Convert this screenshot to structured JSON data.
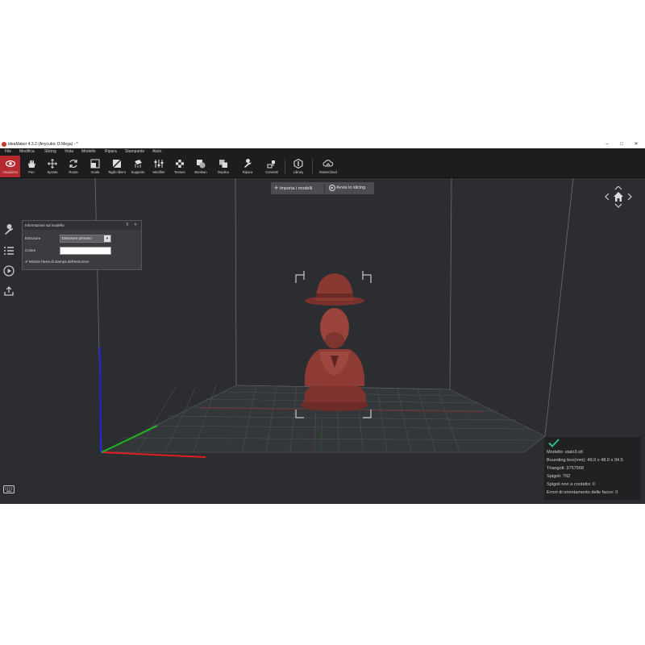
{
  "window": {
    "title": "ideaMaker 4.3.2 (Anycubic I3 Mega) - *",
    "controls": [
      "–",
      "□",
      "✕"
    ]
  },
  "menu": [
    "File",
    "Modifica",
    "Slicing",
    "Vista",
    "Modello",
    "Ripara",
    "Stampante",
    "Aiuto"
  ],
  "toolbar": [
    {
      "label": "Visualizza",
      "icon": "eye-icon",
      "active": true
    },
    {
      "label": "Pan",
      "icon": "hand-icon"
    },
    {
      "label": "Sposta",
      "icon": "move-icon"
    },
    {
      "label": "Ruota",
      "icon": "rotate-icon"
    },
    {
      "label": "Scala",
      "icon": "scale-icon"
    },
    {
      "label": "Taglio libero",
      "icon": "cut-icon"
    },
    {
      "label": "Supporto",
      "icon": "support-icon"
    },
    {
      "label": "Modifier",
      "icon": "modifier-icon"
    },
    {
      "label": "Texture",
      "icon": "texture-icon"
    },
    {
      "label": "Boolean",
      "icon": "boolean-icon"
    },
    {
      "label": "Duplica",
      "icon": "duplicate-icon"
    },
    {
      "label": "Ripara",
      "icon": "repair-icon"
    },
    {
      "label": "Connetti",
      "icon": "connect-icon"
    },
    {
      "label": "Library",
      "icon": "library-icon"
    },
    {
      "label": "RaiseCloud",
      "icon": "cloud-icon"
    }
  ],
  "actions": {
    "import_label": "Importa i modelli",
    "slice_label": "Avvia lo slicing"
  },
  "panel": {
    "title": "Informazioni sul modello",
    "extruder_label": "Estrusore",
    "extruder_value": "Estrusore primario",
    "color_label": "Colore",
    "color_value": "#ffffff",
    "show_area_label": "Mostra l'area di stampa dell'estrusore",
    "show_area_checked": true
  },
  "info": {
    "model": "Modello: stalo3.stl",
    "bbox": "Bounding box(mm): 49.0 x 48.0 x 94.5",
    "triangles": "Triangoli: 3757568",
    "edges": "Spigoli: 792",
    "non_contact": "Spigoli non a contatto: 0",
    "orientation_errors": "Errori di orientamento delle facce: 0"
  },
  "colors": {
    "accent": "#b52a2f",
    "viewport_bg": "#2b2d30",
    "model": "#8e3b35",
    "axis_x": "#e02020",
    "axis_y": "#1fb31f",
    "axis_z": "#2020e0"
  }
}
